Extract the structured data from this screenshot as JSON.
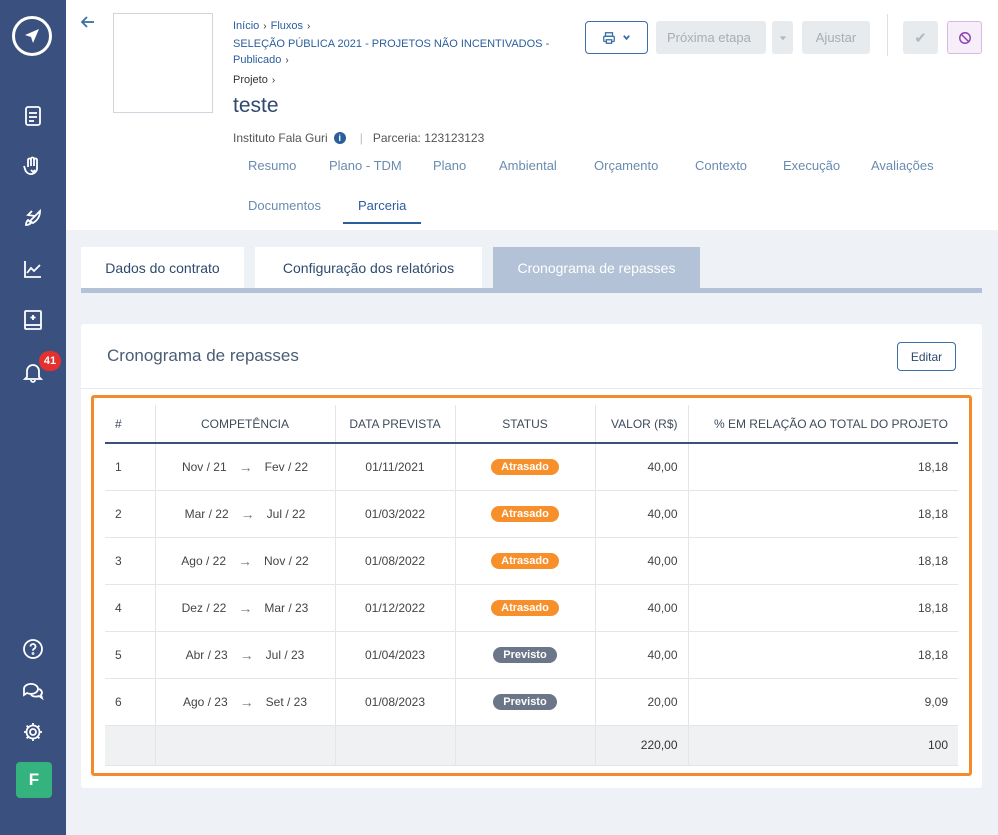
{
  "sidebar": {
    "badge_count": "41",
    "avatar_letter": "F"
  },
  "header": {
    "breadcrumb": {
      "items": [
        "Início",
        "Fluxos",
        "SELEÇÃO PÚBLICA 2021 - PROJETOS NÃO INCENTIVADOS - Publicado"
      ]
    },
    "project_crumb": "Projeto",
    "project_title": "teste",
    "organization": "Instituto Fala Guri",
    "partnership": "Parceria: 123123123",
    "next_step_label": "Próxima etapa",
    "adjust_label": "Ajustar"
  },
  "tabs": [
    {
      "label": "Resumo"
    },
    {
      "label": "Plano - TDM"
    },
    {
      "label": "Plano"
    },
    {
      "label": "Ambiental"
    },
    {
      "label": "Orçamento"
    },
    {
      "label": "Contexto"
    },
    {
      "label": "Execução"
    },
    {
      "label": "Avaliações"
    },
    {
      "label": "Documentos"
    },
    {
      "label": "Parceria"
    }
  ],
  "subtabs": [
    {
      "label": "Dados do contrato"
    },
    {
      "label": "Configuração dos relatórios"
    },
    {
      "label": "Cronograma de repasses"
    }
  ],
  "card": {
    "title": "Cronograma de repasses",
    "edit_label": "Editar"
  },
  "table": {
    "headers": [
      "#",
      "COMPETÊNCIA",
      "DATA PREVISTA",
      "STATUS",
      "VALOR (R$)",
      "% EM RELAÇÃO AO TOTAL DO PROJETO"
    ],
    "rows": [
      {
        "n": "1",
        "from": "Nov / 21",
        "to": "Fev / 22",
        "date": "01/11/2021",
        "status": "Atrasado",
        "value": "40,00",
        "pct": "18,18"
      },
      {
        "n": "2",
        "from": "Mar / 22",
        "to": "Jul / 22",
        "date": "01/03/2022",
        "status": "Atrasado",
        "value": "40,00",
        "pct": "18,18"
      },
      {
        "n": "3",
        "from": "Ago / 22",
        "to": "Nov / 22",
        "date": "01/08/2022",
        "status": "Atrasado",
        "value": "40,00",
        "pct": "18,18"
      },
      {
        "n": "4",
        "from": "Dez / 22",
        "to": "Mar / 23",
        "date": "01/12/2022",
        "status": "Atrasado",
        "value": "40,00",
        "pct": "18,18"
      },
      {
        "n": "5",
        "from": "Abr / 23",
        "to": "Jul / 23",
        "date": "01/04/2023",
        "status": "Previsto",
        "value": "40,00",
        "pct": "18,18"
      },
      {
        "n": "6",
        "from": "Ago / 23",
        "to": "Set / 23",
        "date": "01/08/2023",
        "status": "Previsto",
        "value": "20,00",
        "pct": "9,09"
      }
    ],
    "total_value": "220,00",
    "total_pct": "100"
  },
  "colors": {
    "sidebar": "#3a5180",
    "status_late": "#f7902b",
    "status_planned": "#6b7689",
    "highlight": "#f58a2a"
  }
}
